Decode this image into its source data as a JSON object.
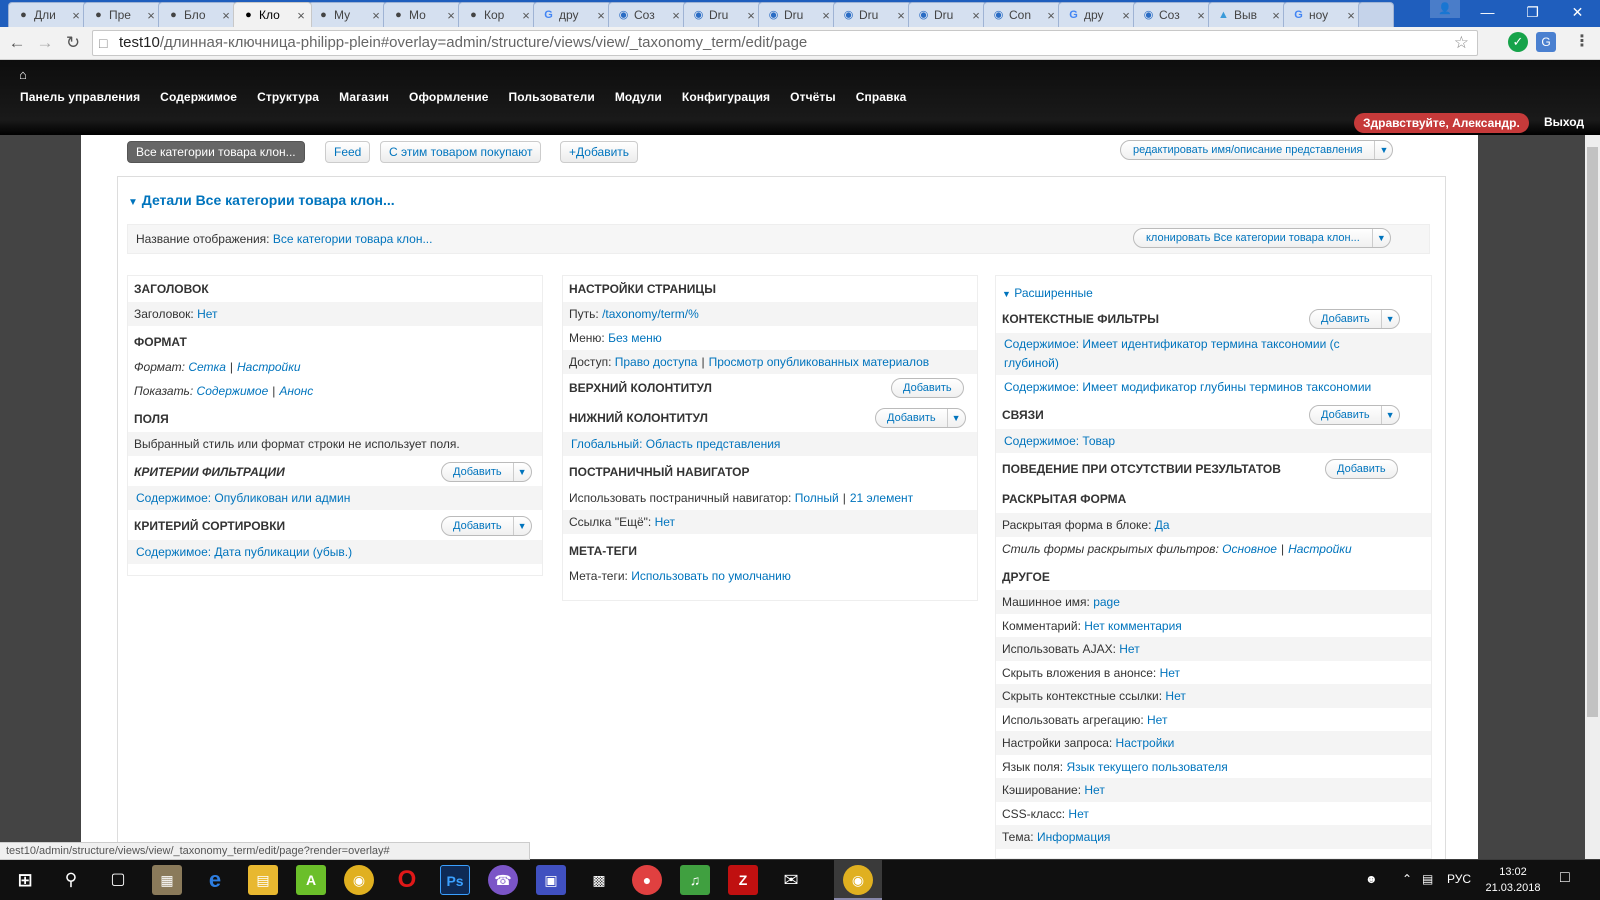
{
  "browser": {
    "tabs": [
      {
        "title": "Дли",
        "icon": "drupal-icon"
      },
      {
        "title": "Пре",
        "icon": "drupal-icon"
      },
      {
        "title": "Бло",
        "icon": "drupal-icon"
      },
      {
        "title": "Кло",
        "icon": "drupal-icon",
        "active": true
      },
      {
        "title": "Му",
        "icon": "drupal-icon"
      },
      {
        "title": "Мо",
        "icon": "drupal-icon"
      },
      {
        "title": "Кор",
        "icon": "drupal-icon"
      },
      {
        "title": "дру",
        "icon": "google-icon"
      },
      {
        "title": "Соз",
        "icon": "site-icon"
      },
      {
        "title": "Dru",
        "icon": "site-icon"
      },
      {
        "title": "Dru",
        "icon": "site-icon"
      },
      {
        "title": "Dru",
        "icon": "site-icon"
      },
      {
        "title": "Dru",
        "icon": "site-icon"
      },
      {
        "title": "Con",
        "icon": "site-icon"
      },
      {
        "title": "дру",
        "icon": "google-icon"
      },
      {
        "title": "Соз",
        "icon": "site-icon"
      },
      {
        "title": "Выв",
        "icon": "drop-icon"
      },
      {
        "title": "ноу",
        "icon": "google-icon"
      }
    ],
    "url_host": "test10",
    "url_path": "/длинная-ключница-philipp-plein#overlay=admin/structure/views/view/_taxonomy_term/edit/page"
  },
  "adminmenu": {
    "items": [
      "Панель управления",
      "Содержимое",
      "Структура",
      "Магазин",
      "Оформление",
      "Пользователи",
      "Модули",
      "Конфигурация",
      "Отчёты",
      "Справка"
    ],
    "greeting_prefix": "Здравствуйте, ",
    "greeting_user": "Александр.",
    "logout": "Выход"
  },
  "views": {
    "displays": [
      "Все категории товара клон...",
      "Feed",
      "С этим товаром покупают"
    ],
    "add_display": "Добавить",
    "edit_name": "редактировать имя/описание представления",
    "details_title": "Детали Все категории товара клон...",
    "display_name_label": "Название отображения:",
    "display_name_value": "Все категории товара клон...",
    "clone_button": "клонировать Все категории товара клон..."
  },
  "col1": {
    "title_h": "ЗАГОЛОВОК",
    "title_label": "Заголовок:",
    "title_value": "Нет",
    "format_h": "ФОРМАТ",
    "format_label": "Формат:",
    "format_value": "Сетка",
    "format_settings": "Настройки",
    "show_label": "Показать:",
    "show_value": "Содержимое",
    "show_mode": "Анонс",
    "fields_h": "ПОЛЯ",
    "fields_note": "Выбранный стиль или формат строки не использует поля.",
    "filter_h": "КРИТЕРИИ ФИЛЬТРАЦИИ",
    "filter_value": "Содержимое: Опубликован или админ",
    "sort_h": "КРИТЕРИЙ СОРТИРОВКИ",
    "sort_value": "Содержимое: Дата публикации (убыв.)",
    "add": "Добавить"
  },
  "col2": {
    "page_h": "НАСТРОЙКИ СТРАНИЦЫ",
    "path_label": "Путь:",
    "path_value": "/taxonomy/term/%",
    "menu_label": "Меню:",
    "menu_value": "Без меню",
    "access_label": "Доступ:",
    "access_value": "Право доступа",
    "access_perm": "Просмотр опубликованных материалов",
    "header_h": "ВЕРХНИЙ КОЛОНТИТУЛ",
    "footer_h": "НИЖНИЙ КОЛОНТИТУЛ",
    "footer_value": "Глобальный: Область представления",
    "pager_h": "ПОСТРАНИЧНЫЙ НАВИГАТОР",
    "pager_label": "Использовать постраничный навигатор:",
    "pager_value": "Полный",
    "pager_items": "21 элемент",
    "more_label": "Ссылка \"Ещё\":",
    "more_value": "Нет",
    "meta_h": "МЕТА-ТЕГИ",
    "meta_label": "Мета-теги:",
    "meta_value": "Использовать по умолчанию",
    "add": "Добавить"
  },
  "col3": {
    "advanced": "Расширенные",
    "context_h": "КОНТЕКСТНЫЕ ФИЛЬТРЫ",
    "context_1a": "Содержимое: Имеет идентификатор термина таксономии (с",
    "context_1b": "глубиной)",
    "context_2": "Содержимое: Имеет модификатор глубины терминов таксономии",
    "rel_h": "СВЯЗИ",
    "rel_value": "Содержимое: Товар",
    "noresult_h": "ПОВЕДЕНИЕ ПРИ ОТСУТСТВИИ РЕЗУЛЬТАТОВ",
    "exposed_h": "РАСКРЫТАЯ ФОРМА",
    "exposed_label": "Раскрытая форма в блоке:",
    "exposed_value": "Да",
    "exposed_style_label": "Стиль формы раскрытых фильтров:",
    "exposed_style_value": "Основное",
    "exposed_style_settings": "Настройки",
    "other_h": "ДРУГОЕ",
    "other": [
      {
        "label": "Машинное имя:",
        "value": "page"
      },
      {
        "label": "Комментарий:",
        "value": "Нет комментария"
      },
      {
        "label": "Использовать AJAX:",
        "value": "Нет"
      },
      {
        "label": "Скрыть вложения в анонсе:",
        "value": "Нет"
      },
      {
        "label": "Скрыть контекстные ссылки:",
        "value": "Нет"
      },
      {
        "label": "Использовать агрегацию:",
        "value": "Нет"
      },
      {
        "label": "Настройки запроса:",
        "value": "Настройки"
      },
      {
        "label": "Язык поля:",
        "value": "Язык текущего пользователя"
      },
      {
        "label": "Кэширование:",
        "value": "Нет"
      },
      {
        "label": "CSS-класс:",
        "value": "Нет"
      },
      {
        "label": "Тема:",
        "value": "Информация"
      }
    ],
    "add": "Добавить"
  },
  "status_url": "test10/admin/structure/views/view/_taxonomy_term/edit/page?render=overlay#",
  "taskbar": {
    "lang": "РУС",
    "time": "13:02",
    "date": "21.03.2018"
  }
}
